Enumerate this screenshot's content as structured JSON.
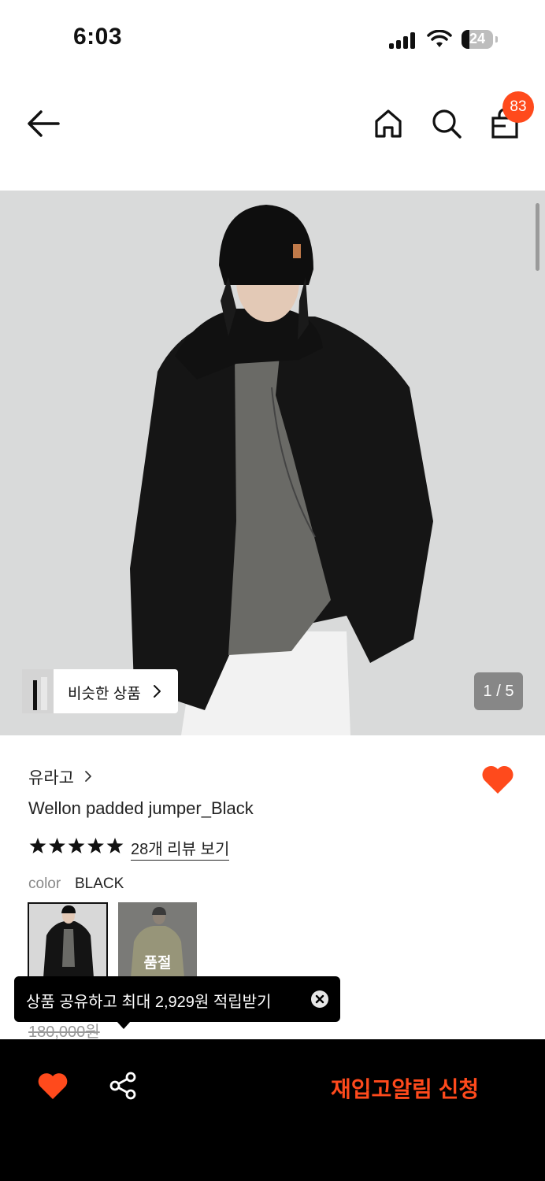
{
  "status_bar": {
    "time": "6:03",
    "battery": "24",
    "battery_level": 0.24
  },
  "header": {
    "cart_count": "83",
    "icons": [
      "back-arrow-icon",
      "home-icon",
      "search-icon",
      "shopping-bag-icon"
    ]
  },
  "gallery": {
    "similar_label": "비슷한 상품",
    "page_indicator": "1 / 5"
  },
  "product": {
    "brand": "유라고",
    "title": "Wellon padded jumper_Black",
    "rating_stars": 5,
    "review_link": "28개 리뷰 보기",
    "color_label": "color",
    "color_value": "BLACK",
    "soldout_label": "품절",
    "original_price": "180,000원"
  },
  "tooltip": {
    "text": "상품 공유하고 최대 2,929원 적립받기"
  },
  "bottom_bar": {
    "restock_label": "재입고알림 신청"
  },
  "colors": {
    "accent": "#ff4a1c",
    "background": "#ffffff",
    "bottom_bar": "#000000"
  }
}
